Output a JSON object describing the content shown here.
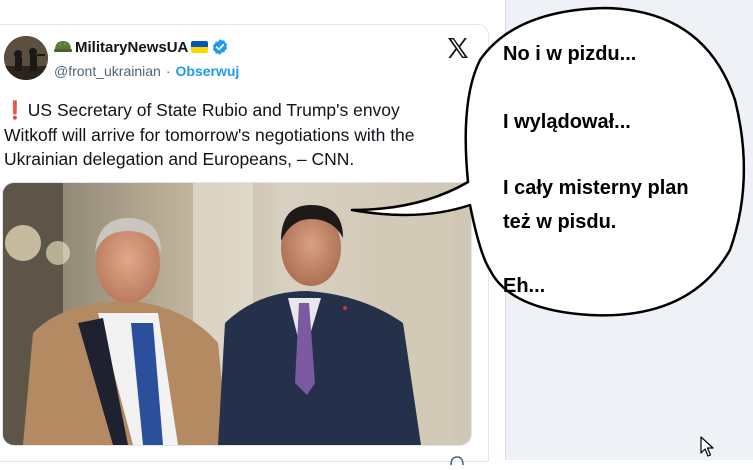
{
  "tweet": {
    "display_name": "MilitaryNewsUA",
    "handle": "@front_ukrainian",
    "separator": "·",
    "follow_label": "Obserwuj",
    "text": "US Secretary of State Rubio and Trump's envoy Witkoff will arrive for tomorrow's negotiations with the Ukrainian delegation and Europeans, – CNN.",
    "icons": {
      "warning": "red-exclamation-icon",
      "helmet": "soldier-helmet-icon",
      "flag": "ukraine-flag-icon",
      "verified": "verified-badge-icon",
      "logo": "x-logo-icon"
    }
  },
  "speech_bubble": {
    "line1": "No i w pizdu...",
    "line2": "I wylądował...",
    "line3": "I cały misterny plan",
    "line4": "też w pisdu.",
    "line5": "Eh..."
  },
  "colors": {
    "link": "#1d9bf0",
    "text": "#0f1419",
    "muted": "#536471",
    "panel": "#eef1f6"
  }
}
